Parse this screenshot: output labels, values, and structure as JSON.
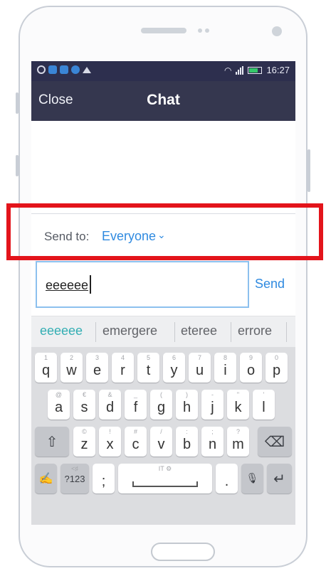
{
  "status_bar": {
    "time": "16:27"
  },
  "header": {
    "close_label": "Close",
    "title": "Chat"
  },
  "send_to": {
    "label": "Send to:",
    "value": "Everyone",
    "caret": "⌄"
  },
  "composer": {
    "input_value": "eeeeee",
    "send_label": "Send"
  },
  "suggestions": [
    "eeeeee",
    "emergere",
    "eteree",
    "errore"
  ],
  "keyboard": {
    "row1": [
      {
        "key": "q",
        "hint": "1"
      },
      {
        "key": "w",
        "hint": "2"
      },
      {
        "key": "e",
        "hint": "3"
      },
      {
        "key": "r",
        "hint": "4"
      },
      {
        "key": "t",
        "hint": "5"
      },
      {
        "key": "y",
        "hint": "6"
      },
      {
        "key": "u",
        "hint": "7"
      },
      {
        "key": "i",
        "hint": "8"
      },
      {
        "key": "o",
        "hint": "9"
      },
      {
        "key": "p",
        "hint": "0"
      }
    ],
    "row2": [
      {
        "key": "a",
        "hint": "@"
      },
      {
        "key": "s",
        "hint": "€"
      },
      {
        "key": "d",
        "hint": "&"
      },
      {
        "key": "f",
        "hint": "_"
      },
      {
        "key": "g",
        "hint": "("
      },
      {
        "key": "h",
        "hint": ")"
      },
      {
        "key": "j",
        "hint": "-"
      },
      {
        "key": "k",
        "hint": "\""
      },
      {
        "key": "l",
        "hint": "'"
      }
    ],
    "row3": [
      {
        "key": "z",
        "hint": "©"
      },
      {
        "key": "x",
        "hint": "!"
      },
      {
        "key": "c",
        "hint": "#"
      },
      {
        "key": "v",
        "hint": "/"
      },
      {
        "key": "b",
        "hint": ":"
      },
      {
        "key": "n",
        "hint": ";"
      },
      {
        "key": "m",
        "hint": "?"
      }
    ],
    "symbols_label": "?123",
    "symbols_hint": "<♯",
    "comma_key": ";",
    "space_hint": "IT ⚙",
    "period_key": ".",
    "shift_icon": "⇧",
    "backspace_icon": "⌫",
    "enter_icon": "↵",
    "handwriting_icon": "✍",
    "mic_icon": "🎙"
  },
  "colors": {
    "accent": "#2f8ae0",
    "header_bg": "#35374f",
    "status_bg": "#2d2f4e",
    "suggestion_active": "#33aeb3"
  }
}
